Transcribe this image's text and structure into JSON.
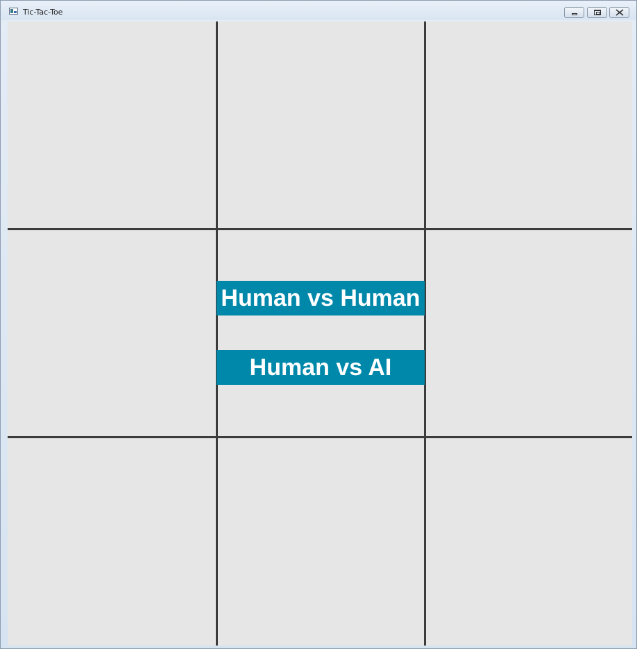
{
  "window": {
    "title": "Tic-Tac-Toe",
    "icons": {
      "app": "app-icon",
      "minimize": "minimize-icon",
      "maximize": "maximize-icon",
      "close": "close-icon"
    }
  },
  "board": {
    "background": "#e6e6e6",
    "grid_color": "#3c3c3c",
    "cells": [
      "",
      "",
      "",
      "",
      "",
      "",
      "",
      "",
      ""
    ]
  },
  "menu": {
    "button_color": "#0088aa",
    "human_vs_human": "Human vs Human",
    "human_vs_ai": "Human vs AI"
  }
}
